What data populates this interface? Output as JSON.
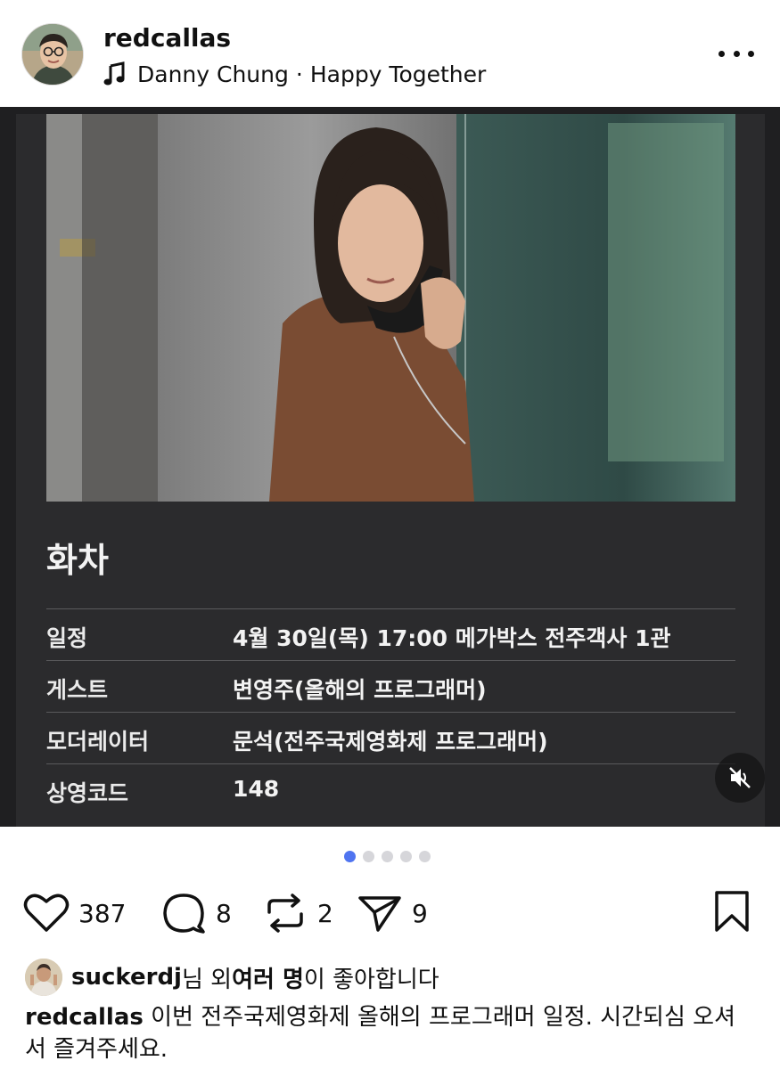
{
  "header": {
    "username": "redcallas",
    "music_artist": "Danny Chung",
    "music_separator": "·",
    "music_track": "Happy Together",
    "icons": {
      "music": "music-note-icon",
      "more": "more-options-icon"
    }
  },
  "post": {
    "movie_title": "화차",
    "info": [
      {
        "label": "일정",
        "value": "4월 30일(목) 17:00 메가박스 전주객사 1관"
      },
      {
        "label": "게스트",
        "value": "변영주(올해의 프로그래머)"
      },
      {
        "label": "모더레이터",
        "value": "문석(전주국제영화제 프로그래머)"
      },
      {
        "label": "상영코드",
        "value": "148"
      }
    ],
    "icons": {
      "mute": "muted-speaker-icon"
    }
  },
  "carousel": {
    "count": 5,
    "active": 1
  },
  "actions": {
    "likes": "387",
    "comments": "8",
    "reposts": "2",
    "shares": "9",
    "icons": {
      "like": "heart-icon",
      "comment": "comment-icon",
      "repost": "repost-icon",
      "share": "send-icon",
      "save": "bookmark-icon"
    }
  },
  "likes_line": {
    "user": "suckerdj",
    "text1": "님 외 ",
    "bold": "여러 명",
    "text2": "이 좋아합니다"
  },
  "caption": {
    "user": "redcallas",
    "text": "이번 전주국제영화제 올해의 프로그래머 일정. 시간되심 오셔서 즐겨주세요."
  },
  "colors": {
    "accent_dot": "#4f74f0",
    "card_bg": "#2b2b2d",
    "post_bg": "#1f1f21"
  }
}
